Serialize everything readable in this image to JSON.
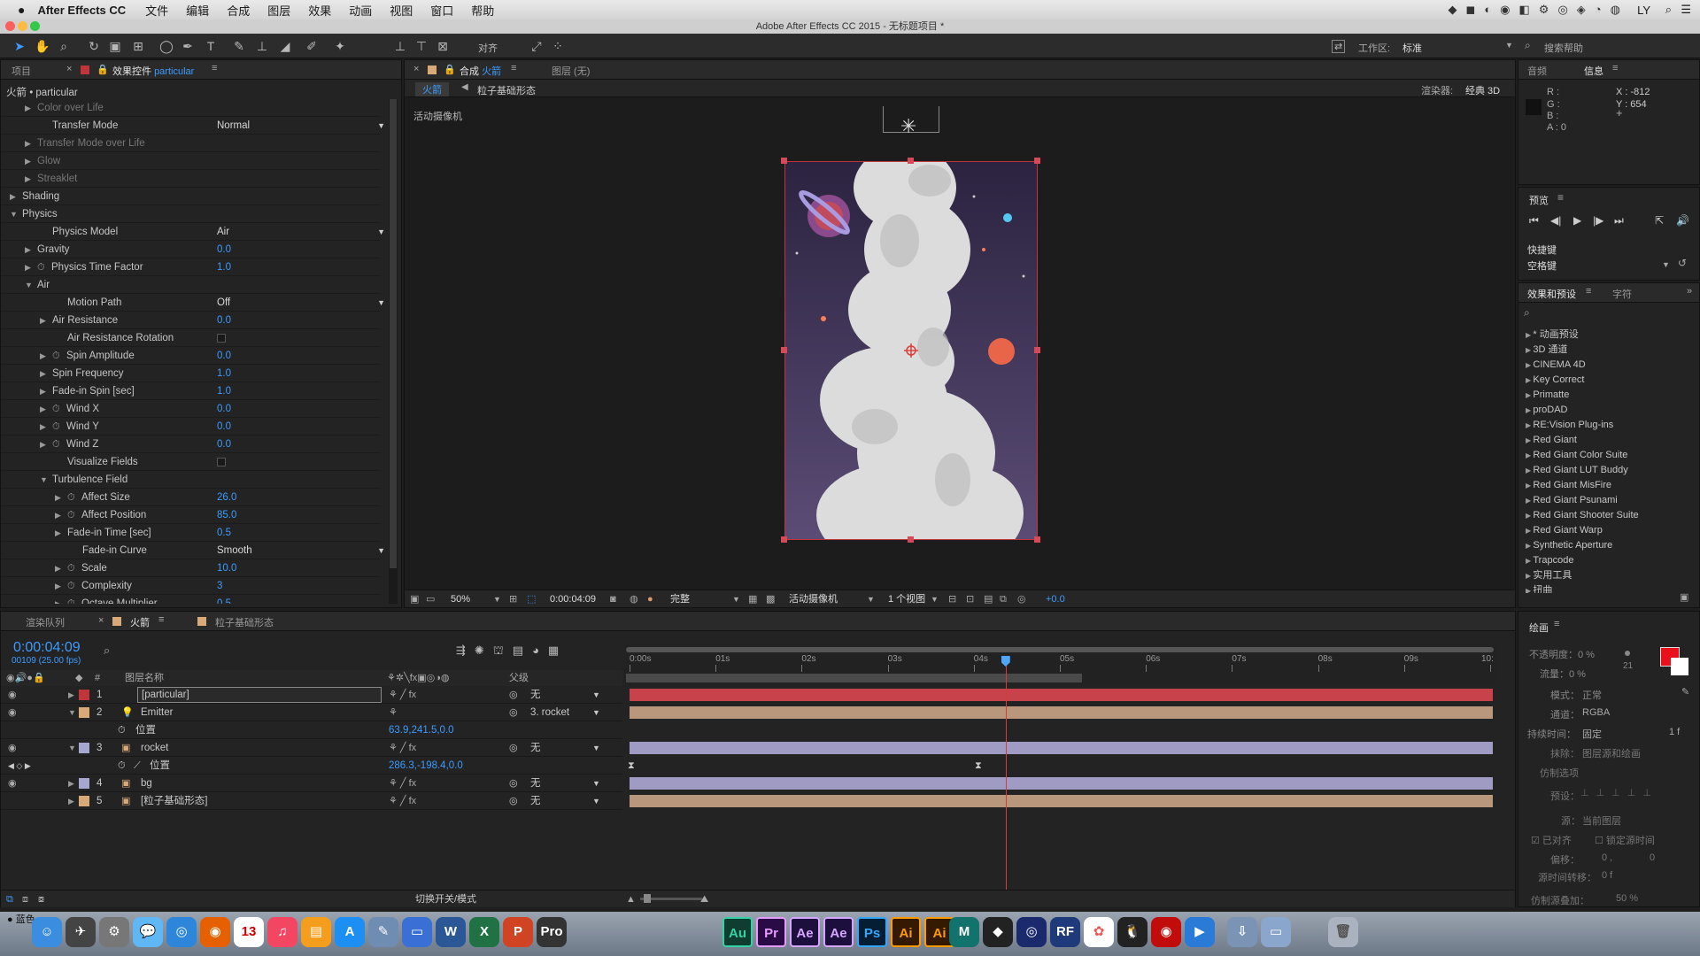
{
  "menubar": {
    "app": "After Effects CC",
    "items": [
      "文件",
      "编辑",
      "合成",
      "图层",
      "效果",
      "动画",
      "视图",
      "窗口",
      "帮助"
    ],
    "user": "LY"
  },
  "window_title": "Adobe After Effects CC 2015 - 无标题项目 *",
  "toolbar": {
    "align_label": "对齐",
    "workspace_label": "工作区:",
    "workspace_value": "标准",
    "search_placeholder": "搜索帮助"
  },
  "effect_panel": {
    "tabs": {
      "project": "项目",
      "effect_prefix": "效果控件",
      "effect_layer": "particular"
    },
    "breadcrumb": "火箭 • particular",
    "rows": [
      {
        "label": "Color over Life",
        "indent": 1,
        "tri": "▶",
        "dim": true
      },
      {
        "label": "Transfer Mode",
        "indent": 2,
        "select": "Normal"
      },
      {
        "label": "Transfer Mode over Life",
        "indent": 1,
        "tri": "▶",
        "dim": true
      },
      {
        "label": "Glow",
        "indent": 1,
        "tri": "▶",
        "dim": true
      },
      {
        "label": "Streaklet",
        "indent": 1,
        "tri": "▶",
        "dim": true
      },
      {
        "label": "Shading",
        "indent": 0,
        "tri": "▶"
      },
      {
        "label": "Physics",
        "indent": 0,
        "tri": "▼"
      },
      {
        "label": "Physics Model",
        "indent": 2,
        "select": "Air"
      },
      {
        "label": "Gravity",
        "indent": 1,
        "tri": "▶",
        "value": "0.0"
      },
      {
        "label": "Physics Time Factor",
        "indent": 1,
        "tri": "▶",
        "stopwatch": true,
        "value": "1.0"
      },
      {
        "label": "Air",
        "indent": 1,
        "tri": "▼"
      },
      {
        "label": "Motion Path",
        "indent": 3,
        "select": "Off"
      },
      {
        "label": "Air Resistance",
        "indent": 2,
        "tri": "▶",
        "value": "0.0"
      },
      {
        "label": "Air Resistance Rotation",
        "indent": 3,
        "check": true
      },
      {
        "label": "Spin Amplitude",
        "indent": 2,
        "tri": "▶",
        "stopwatch": true,
        "value": "0.0"
      },
      {
        "label": "Spin Frequency",
        "indent": 2,
        "tri": "▶",
        "value": "1.0"
      },
      {
        "label": "Fade-in Spin [sec]",
        "indent": 2,
        "tri": "▶",
        "value": "1.0"
      },
      {
        "label": "Wind X",
        "indent": 2,
        "tri": "▶",
        "stopwatch": true,
        "value": "0.0"
      },
      {
        "label": "Wind Y",
        "indent": 2,
        "tri": "▶",
        "stopwatch": true,
        "value": "0.0"
      },
      {
        "label": "Wind Z",
        "indent": 2,
        "tri": "▶",
        "stopwatch": true,
        "value": "0.0"
      },
      {
        "label": "Visualize Fields",
        "indent": 3,
        "check": true
      },
      {
        "label": "Turbulence Field",
        "indent": 2,
        "tri": "▼"
      },
      {
        "label": "Affect Size",
        "indent": 3,
        "tri": "▶",
        "stopwatch": true,
        "value": "26.0"
      },
      {
        "label": "Affect Position",
        "indent": 3,
        "tri": "▶",
        "stopwatch": true,
        "value": "85.0"
      },
      {
        "label": "Fade-in Time [sec]",
        "indent": 3,
        "tri": "▶",
        "value": "0.5"
      },
      {
        "label": "Fade-in Curve",
        "indent": 4,
        "select": "Smooth"
      },
      {
        "label": "Scale",
        "indent": 3,
        "tri": "▶",
        "stopwatch": true,
        "value": "10.0"
      },
      {
        "label": "Complexity",
        "indent": 3,
        "tri": "▶",
        "stopwatch": true,
        "value": "3"
      },
      {
        "label": "Octave Multiplier",
        "indent": 3,
        "tri": "▶",
        "stopwatch": true,
        "value": "0.5"
      }
    ]
  },
  "comp_panel": {
    "tab_comp_prefix": "合成",
    "tab_comp": "火箭",
    "tab_layer": "图层 (无)",
    "crumb1": "火箭",
    "crumb2": "粒子基础形态",
    "renderer_label": "渲染器:",
    "renderer_value": "经典 3D",
    "camera_label": "活动摄像机",
    "footer": {
      "zoom": "50%",
      "timecode": "0:00:04:09",
      "quality": "完整",
      "camera": "活动摄像机",
      "views": "1 个视图",
      "exposure": "+0.0"
    }
  },
  "info_panel": {
    "tabs": [
      "音频",
      "信息"
    ],
    "r": "R :",
    "g": "G :",
    "b": "B :",
    "a": "A : 0",
    "x": "X : -812",
    "y": "Y : 654"
  },
  "preview_panel": {
    "title": "预览",
    "shortcut_label": "快捷键",
    "shortcut_value": "空格键"
  },
  "effects_presets": {
    "tabs": [
      "效果和预设",
      "字符"
    ],
    "items": [
      "* 动画预设",
      "3D 通道",
      "CINEMA 4D",
      "Key Correct",
      "Primatte",
      "proDAD",
      "RE:Vision Plug-ins",
      "Red Giant",
      "Red Giant Color Suite",
      "Red Giant LUT Buddy",
      "Red Giant MisFire",
      "Red Giant Psunami",
      "Red Giant Shooter Suite",
      "Red Giant Warp",
      "Synthetic Aperture",
      "Trapcode",
      "实用工具",
      "扭曲"
    ]
  },
  "timeline": {
    "tabs": [
      "渲染队列",
      "火箭",
      "粒子基础形态"
    ],
    "timecode": "0:00:04:09",
    "frames": "00109 (25.00 fps)",
    "col_num": "#",
    "col_name": "图层名称",
    "col_parent": "父级",
    "ruler": [
      "0:00s",
      "01s",
      "02s",
      "03s",
      "04s",
      "05s",
      "06s",
      "07s",
      "08s",
      "09s",
      "10:"
    ],
    "playhead_seconds": 4.37,
    "duration_seconds": 10,
    "work_area_end_seconds": 5.3,
    "layers": [
      {
        "num": "1",
        "name": "[particular]",
        "color": "#c0343a",
        "parent": "无",
        "bar": "#c8424c"
      },
      {
        "num": "2",
        "name": "Emitter",
        "color": "#d9a978",
        "parent": "3. rocket",
        "bar": "#b9977d",
        "expanded": true
      },
      {
        "prop": true,
        "name": "位置",
        "value": "63.9,241.5,0.0"
      },
      {
        "num": "3",
        "name": "rocket",
        "color": "#a6a6d0",
        "parent": "无",
        "bar": "#9f9bc2",
        "expanded": true
      },
      {
        "prop": true,
        "name": "位置",
        "value": "286.3,-198.4,0.0",
        "keyed": true
      },
      {
        "num": "4",
        "name": "bg",
        "color": "#a6a6d0",
        "parent": "无",
        "bar": "#9f9bc2"
      },
      {
        "num": "5",
        "name": "[粒子基础形态]",
        "color": "#d9a978",
        "parent": "无",
        "bar": "#b9977d"
      }
    ],
    "footer_label": "切换开关/模式"
  },
  "paint_panel": {
    "title": "绘画",
    "opacity": "不透明度：0 %",
    "flow": "流量：0 %",
    "mode_label": "模式：",
    "mode_value": "正常",
    "channel_label": "通道：",
    "channel_value": "RGBA",
    "duration_label": "持续时间：",
    "duration_value": "固定",
    "duration_frames": "1 f",
    "erase_label": "抹除：",
    "erase_value": "图层源和绘画",
    "clone_label": "仿制选项",
    "preset_label": "预设：",
    "source_label": "源：",
    "source_value": "当前图层",
    "aligned": "已对齐",
    "lock_source": "锁定源时间",
    "offset_label": "偏移：",
    "offset_x": "0 ,",
    "offset_y": "0",
    "source_time_label": "源时间转移：",
    "source_time_value": "0 f",
    "clone_overlay": "仿制源叠加：",
    "clone_overlay_value": "50 %"
  },
  "colors": {
    "accent": "#3d9bff",
    "paint_fg": "#e8101a",
    "sky_top": "#2e2646",
    "sky_bottom": "#5a4a72"
  },
  "dock": {
    "items": [
      {
        "label": "Au",
        "bg": "#0f3d30",
        "fg": "#33d3a5"
      },
      {
        "label": "Pr",
        "bg": "#2a0b45",
        "fg": "#e69bff"
      },
      {
        "label": "Ae",
        "bg": "#1d0f3d",
        "fg": "#d6a5ff"
      },
      {
        "label": "Ae",
        "bg": "#1d0f3d",
        "fg": "#d6a5ff"
      },
      {
        "label": "Ps",
        "bg": "#061e33",
        "fg": "#31a8ff"
      },
      {
        "label": "Ai",
        "bg": "#331a00",
        "fg": "#ff9a00"
      },
      {
        "label": "Ai",
        "bg": "#331a00",
        "fg": "#ff9a00"
      }
    ]
  }
}
